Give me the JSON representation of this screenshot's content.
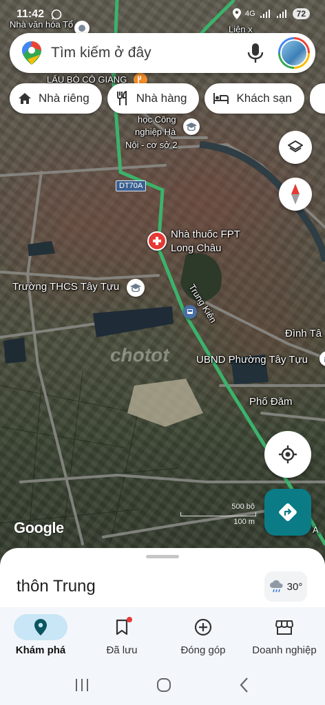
{
  "status_bar": {
    "time": "11:42",
    "network": "4G",
    "battery": "72"
  },
  "search": {
    "placeholder": "Tìm kiếm ở đây"
  },
  "chips": [
    {
      "label": "Nhà riêng",
      "icon": "home-icon"
    },
    {
      "label": "Nhà hàng",
      "icon": "restaurant-icon"
    },
    {
      "label": "Khách sạn",
      "icon": "hotel-icon"
    }
  ],
  "map": {
    "labels": {
      "nha_van_hoa": "Nhà văn hóa Tổ",
      "lien": "Liên x",
      "lau_bo": "LẨU BÒ CÔ GIANG",
      "hoc_cong": "học Công",
      "nghiep_ha": "nghiệp Hà",
      "noi_co_so": "Nội - cơ sở 2",
      "road_shield": "DT70A",
      "pharmacy_line1": "Nhà thuốc FPT",
      "pharmacy_line2": "Long Châu",
      "school": "Trường THCS Tây Tựu",
      "street_trung_kien": "Trung Kiên",
      "dinh_tay": "Đình Tâ",
      "ubnd": "UBND Phường Tây Tựu",
      "pho_dam": "Phố Đăm",
      "watermark": "chotot",
      "scale_top": "500 bộ",
      "scale_bottom": "100 m",
      "edge_a": "A",
      "google": "Google"
    }
  },
  "sheet": {
    "place_name": "thôn Trung",
    "temperature": "30°"
  },
  "bottom_nav": [
    {
      "label": "Khám phá",
      "icon": "explore-pin-icon",
      "active": true
    },
    {
      "label": "Đã lưu",
      "icon": "saved-bookmark-icon",
      "active": false
    },
    {
      "label": "Đóng góp",
      "icon": "contribute-plus-icon",
      "active": false
    },
    {
      "label": "Doanh nghiệp",
      "icon": "business-store-icon",
      "active": false
    }
  ],
  "colors": {
    "route_green": "#3bb36b",
    "directions_teal": "#0b7c86",
    "poi_red": "#e53935",
    "explore_active_bg": "#c8e6f5"
  }
}
